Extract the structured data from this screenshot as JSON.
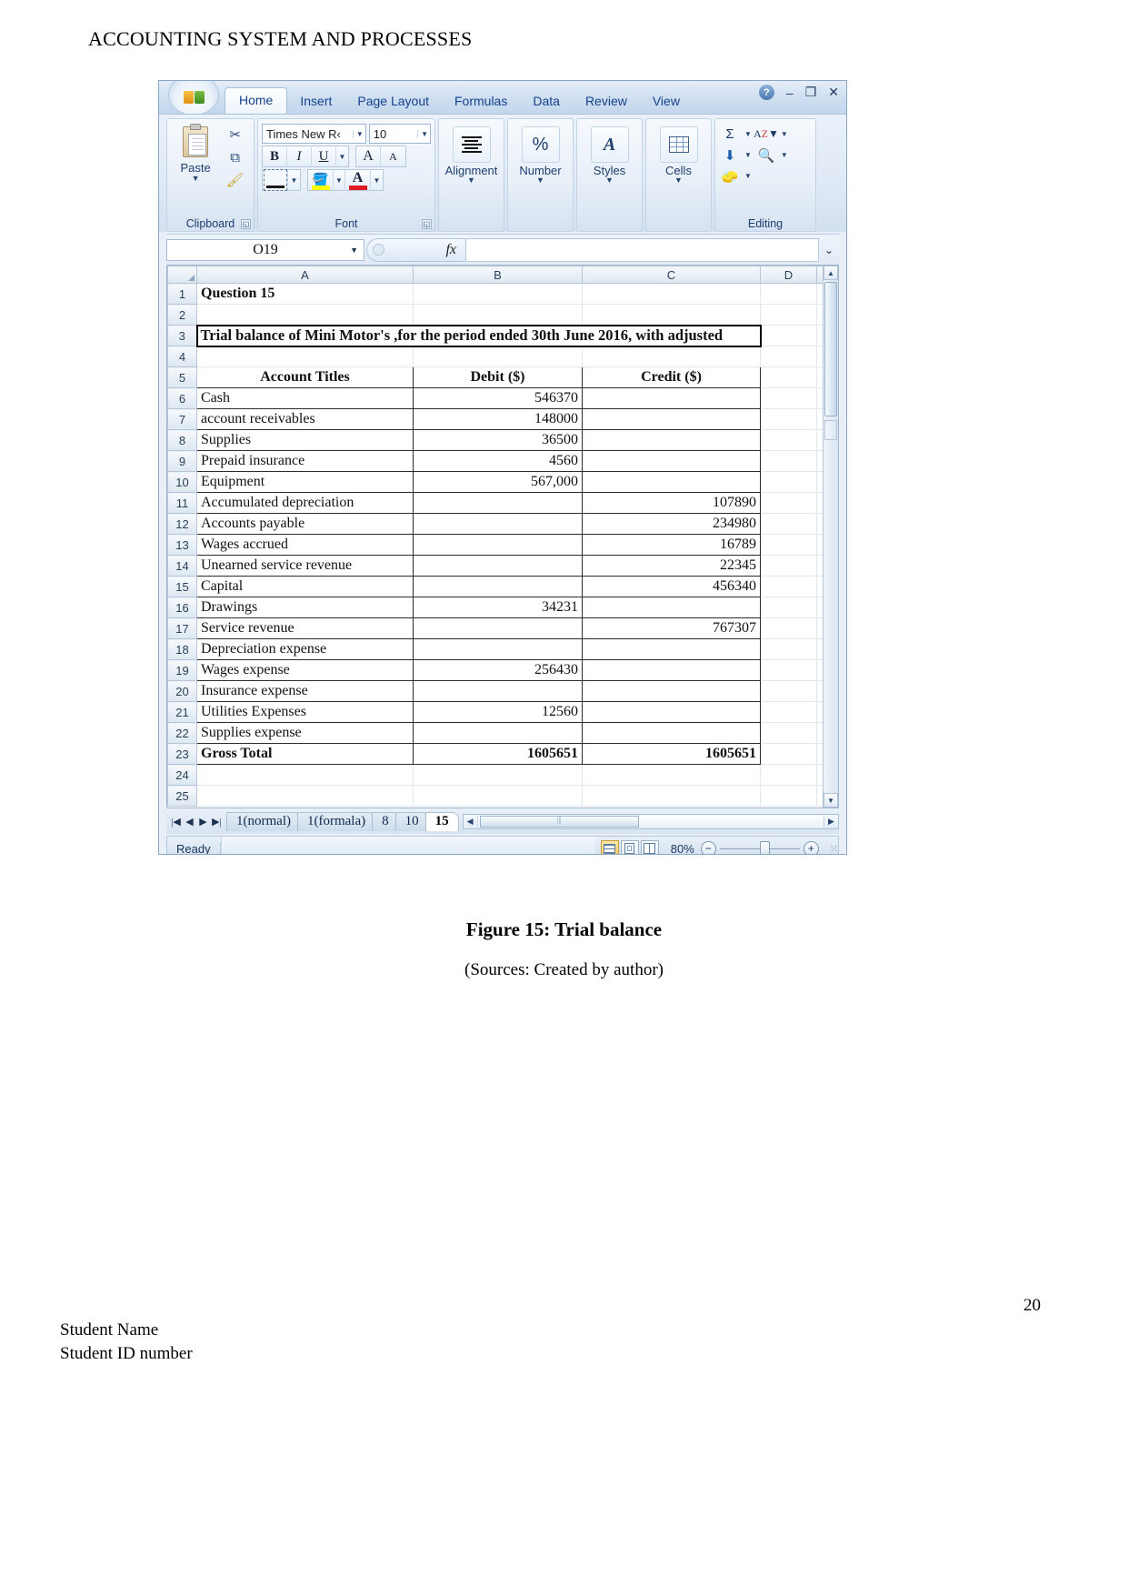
{
  "document": {
    "header_title": "ACCOUNTING SYSTEM AND PROCESSES",
    "figure_caption": "Figure 15: Trial balance",
    "figure_source": "(Sources: Created by author)",
    "page_number": "20",
    "footer_line1": "Student Name",
    "footer_line2": "Student ID number"
  },
  "excel": {
    "ribbon_tabs": [
      "Home",
      "Insert",
      "Page Layout",
      "Formulas",
      "Data",
      "Review",
      "View"
    ],
    "active_tab": "Home",
    "window_controls": {
      "help": "?",
      "minimize": "–",
      "restore": "❐",
      "close": "✕"
    },
    "groups": {
      "clipboard": {
        "label": "Clipboard",
        "paste_label": "Paste",
        "cut_icon": "scissors-icon",
        "copy_icon": "copy-icon",
        "format_painter_icon": "paintbrush-icon"
      },
      "font": {
        "label": "Font",
        "font_name": "Times New R‹",
        "font_size": "10",
        "bold": "B",
        "italic": "I",
        "underline": "U",
        "grow_font": "A",
        "shrink_font": "A",
        "borders_icon": "borders-icon",
        "fill_color": "A",
        "font_color": "A"
      },
      "alignment": {
        "label": "Alignment"
      },
      "number": {
        "label": "Number",
        "icon_glyph": "%"
      },
      "styles": {
        "label": "Styles",
        "icon_glyph": "A"
      },
      "cells": {
        "label": "Cells",
        "icon_glyph": "table-icon"
      },
      "editing": {
        "label": "Editing",
        "autosum": "Σ",
        "sort_filter": "AZ",
        "fill": "fill-down-icon",
        "find_select": "binoculars-icon",
        "clear": "eraser-icon"
      }
    },
    "formula_bar": {
      "name_box": "O19",
      "fx_label": "fx",
      "formula_value": ""
    },
    "columns": [
      "A",
      "B",
      "C",
      "D"
    ],
    "sheet_tabs": [
      "1(normal)",
      "1(formala)",
      "8",
      "10",
      "15"
    ],
    "active_sheet": "15",
    "status": {
      "ready": "Ready",
      "zoom": "80%"
    }
  },
  "sheet_data": {
    "rows": [
      {
        "n": "1",
        "a": "Question 15",
        "b": "",
        "c": "",
        "style": "bold"
      },
      {
        "n": "2",
        "a": "",
        "b": "",
        "c": "",
        "style": "blank"
      },
      {
        "n": "3",
        "a": "Trial balance of Mini Motor's ,for the period ended 30th June 2016, with adjusted",
        "b": "",
        "c": "",
        "style": "title"
      },
      {
        "n": "4",
        "a": "",
        "b": "",
        "c": "",
        "style": "blank"
      },
      {
        "n": "5",
        "a": "Account Titles",
        "b": "Debit ($)",
        "c": "Credit ($)",
        "style": "header"
      },
      {
        "n": "6",
        "a": "Cash",
        "b": "546370",
        "c": "",
        "style": "data"
      },
      {
        "n": "7",
        "a": "account receivables",
        "b": "148000",
        "c": "",
        "style": "data"
      },
      {
        "n": "8",
        "a": "Supplies",
        "b": "36500",
        "c": "",
        "style": "data"
      },
      {
        "n": "9",
        "a": "Prepaid insurance",
        "b": "4560",
        "c": "",
        "style": "data"
      },
      {
        "n": "10",
        "a": "Equipment",
        "b": "567,000",
        "c": "",
        "style": "data"
      },
      {
        "n": "11",
        "a": "Accumulated depreciation",
        "b": "",
        "c": "107890",
        "style": "data"
      },
      {
        "n": "12",
        "a": "Accounts payable",
        "b": "",
        "c": "234980",
        "style": "data"
      },
      {
        "n": "13",
        "a": "Wages accrued",
        "b": "",
        "c": "16789",
        "style": "data"
      },
      {
        "n": "14",
        "a": "Unearned service revenue",
        "b": "",
        "c": "22345",
        "style": "data"
      },
      {
        "n": "15",
        "a": "Capital",
        "b": "",
        "c": "456340",
        "style": "data"
      },
      {
        "n": "16",
        "a": "Drawings",
        "b": "34231",
        "c": "",
        "style": "data"
      },
      {
        "n": "17",
        "a": "Service revenue",
        "b": "",
        "c": "767307",
        "style": "data"
      },
      {
        "n": "18",
        "a": "Depreciation expense",
        "b": "",
        "c": "",
        "style": "data"
      },
      {
        "n": "19",
        "a": "Wages expense",
        "b": "256430",
        "c": "",
        "style": "data"
      },
      {
        "n": "20",
        "a": "Insurance expense",
        "b": "",
        "c": "",
        "style": "data"
      },
      {
        "n": "21",
        "a": "Utilities Expenses",
        "b": "12560",
        "c": "",
        "style": "data"
      },
      {
        "n": "22",
        "a": "Supplies expense",
        "b": "",
        "c": "",
        "style": "data"
      },
      {
        "n": "23",
        "a": "Gross Total",
        "b": "1605651",
        "c": "1605651",
        "style": "total"
      },
      {
        "n": "24",
        "a": "",
        "b": "",
        "c": "",
        "style": "blank"
      },
      {
        "n": "25",
        "a": "",
        "b": "",
        "c": "",
        "style": "blank"
      }
    ]
  }
}
